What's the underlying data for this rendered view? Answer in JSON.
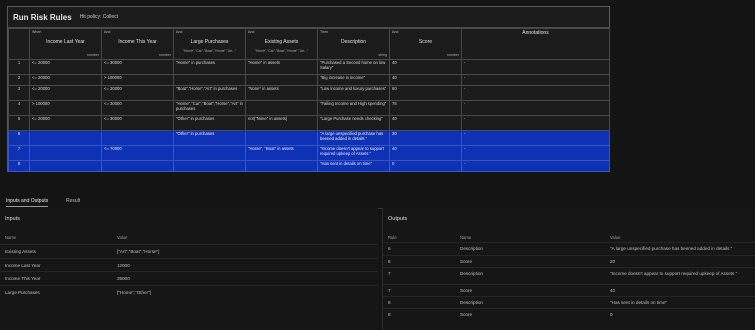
{
  "table": {
    "title": "Run Risk Rules",
    "hit_policy_label": "Hit policy:",
    "hit_policy_value": "Collect",
    "columns": [
      {
        "kind": "When",
        "name": "Income Last Year",
        "type": "number",
        "sub": ""
      },
      {
        "kind": "And",
        "name": "Income This Year",
        "type": "number",
        "sub": ""
      },
      {
        "kind": "And",
        "name": "Large Purchases",
        "type": "",
        "sub": "\"Home\",\"Car\",\"Boat\",\"Home\",\"Art...\""
      },
      {
        "kind": "And",
        "name": "Existing Assets",
        "type": "",
        "sub": "\"Home\",\"Car\",\"Boat\",\"Home\",\"Art...\""
      },
      {
        "kind": "Then",
        "name": "Description",
        "type": "string",
        "sub": ""
      },
      {
        "kind": "And",
        "name": "Score",
        "type": "number",
        "sub": ""
      },
      {
        "kind": "",
        "name": "Annotations",
        "type": "",
        "sub": ""
      }
    ],
    "rows": [
      {
        "n": "1",
        "cells": [
          "<= 20000",
          "<= 30000",
          "\"Home\" in purchases",
          "\"Home\" in assets",
          "\"Purchased a Second home on low Salary\"",
          "40",
          "-"
        ]
      },
      {
        "n": "2",
        "cells": [
          "<= 20000",
          "> 100000",
          "",
          "",
          "\"Big increase in income\"",
          "40",
          "-"
        ]
      },
      {
        "n": "3",
        "cells": [
          "<= 20000",
          "<= 30000",
          "\"Boat\",\"Horse\",\"Art\" in purchases",
          "\"None\" in assets",
          "\"Low income and luxury purchases\"",
          "60",
          "-"
        ]
      },
      {
        "n": "4",
        "cells": [
          "> 100000",
          "<= 30000",
          "\"Home\",\"Car\",\"Boat\",\"Horse\",\"Art\" in purchases",
          "",
          "\"Falling Income and High spending\"",
          "75",
          "-"
        ]
      },
      {
        "n": "5",
        "cells": [
          "<= 20000",
          "<= 30000",
          "\"Other\" in purchases",
          "not(\"None\" in assets)",
          "\"Large Purchase needs checking\"",
          "40",
          "-"
        ]
      },
      {
        "n": "6",
        "cells": [
          "",
          "",
          "\"Other\" in purchases",
          "",
          "\"A large unspecified purchase has beened added in details \"",
          "20",
          "-"
        ]
      },
      {
        "n": "7",
        "cells": [
          "",
          "<= 70000",
          "",
          "\"Horse\", \"Boat\" in assets",
          "\"Income doesn't appear to support required upkeep of Assets \"",
          "40",
          "-"
        ]
      },
      {
        "n": "8",
        "cells": [
          "",
          "",
          "",
          "",
          "\"Has sent in details on time\"",
          "0",
          "-"
        ]
      }
    ]
  },
  "tabs": [
    {
      "label": "Inputs and Outputs",
      "active": true
    },
    {
      "label": "Result",
      "active": false
    }
  ],
  "inputs": {
    "title": "Inputs",
    "col_name": "Name",
    "col_value": "Value",
    "rows": [
      {
        "name": "Existing Assets",
        "value": "[\"Art\",\"Boat\",\"Horse\"]"
      },
      {
        "name": "Income Last Year",
        "value": "12000"
      },
      {
        "name": "Income This Year",
        "value": "35000"
      },
      {
        "name": "Large Purchases",
        "value": "[\"Home\",\"Other\"]"
      }
    ]
  },
  "outputs": {
    "title": "Outputs",
    "col_rule": "Rule",
    "col_name": "Name",
    "col_value": "Value",
    "rows": [
      {
        "rule": "6",
        "name": "Description",
        "value": "\"A large unspecified purchase has beened added in details \""
      },
      {
        "rule": "6",
        "name": "Score",
        "value": "20"
      },
      {
        "rule": "7",
        "name": "Description",
        "value": "\"Income doesn't appear to support required upkeep of Assets \""
      },
      {
        "rule": "7",
        "name": "Score",
        "value": "40"
      },
      {
        "rule": "8",
        "name": "Description",
        "value": "\"Has sent in details on time\""
      },
      {
        "rule": "8",
        "name": "Score",
        "value": "0"
      }
    ]
  },
  "colors": {
    "selected_row": "#0f31b3",
    "background": "#141414",
    "border": "#4a4a4a"
  }
}
